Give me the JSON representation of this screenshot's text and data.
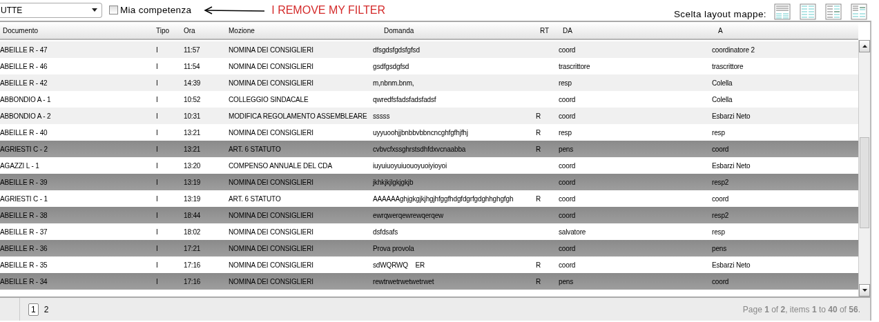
{
  "toolbar": {
    "filter": {
      "value": "UTTE"
    },
    "mia_competenza": {
      "label": "Mia competenza",
      "checked": false
    },
    "annotation": "I REMOVE MY FILTER",
    "layout_picker": {
      "label": "Scelta layout mappe:",
      "options": [
        {
          "kind": "top-list"
        },
        {
          "kind": "two-columns"
        },
        {
          "kind": "left-list"
        },
        {
          "kind": "corner-list"
        }
      ]
    }
  },
  "table": {
    "columns": [
      "Documento",
      "Tipo",
      "Ora",
      "Mozione",
      "Domanda",
      "RT",
      "DA",
      "A"
    ],
    "rows": [
      {
        "documento": "ABEILLE R - 47",
        "tipo": "I",
        "ora": "11:57",
        "mozione": "NOMINA DEI CONSIGLIERI",
        "domanda": "dfsgdsfgdsfgfsd",
        "da": "coord",
        "a": "coordinatore 2",
        "highlighted": false
      },
      {
        "documento": "ABEILLE R - 46",
        "tipo": "I",
        "ora": "11:54",
        "mozione": "NOMINA DEI CONSIGLIERI",
        "domanda": "gsdfgsdgfsd",
        "da": "trascrittore",
        "a": "trascrittore",
        "highlighted": false
      },
      {
        "documento": "ABEILLE R - 42",
        "tipo": "I",
        "ora": "14:39",
        "mozione": "NOMINA DEI CONSIGLIERI",
        "domanda": "m,nbnm.bnm,",
        "da": "resp",
        "a": "Colella",
        "highlighted": false
      },
      {
        "documento": "ABBONDIO A - 1",
        "tipo": "I",
        "ora": "10:52",
        "mozione": "COLLEGGIO SINDACALE",
        "domanda": "qwredfsfadsfadsfadsf",
        "da": "coord",
        "a": "Colella",
        "highlighted": false
      },
      {
        "documento": "ABBONDIO A - 2",
        "tipo": "I",
        "ora": "10:31",
        "mozione": "MODIFICA REGOLAMENTO ASSEMBLEARE",
        "domanda": "sssss",
        "rt": "R",
        "da": "coord",
        "a": "Esbarzi Neto",
        "highlighted": false
      },
      {
        "documento": "ABEILLE R - 40",
        "tipo": "I",
        "ora": "13:21",
        "mozione": "NOMINA DEI CONSIGLIERI",
        "domanda": "uyyuoohjjbnbbvbbncncghfgfhjfhj",
        "rt": "R",
        "da": "resp",
        "a": "resp",
        "highlighted": false
      },
      {
        "documento": "AGRIESTI C - 2",
        "tipo": "I",
        "ora": "13:21",
        "mozione": "ART. 6 STATUTO",
        "domanda": "cvbvcfxssghrstsdhfdxvcnaabba",
        "rt": "R",
        "da": "pens",
        "a": "coord",
        "highlighted": true
      },
      {
        "documento": "AGAZZI L - 1",
        "tipo": "I",
        "ora": "13:20",
        "mozione": "COMPENSO ANNUALE DEL CDA",
        "domanda": "iuyuiuoyuiuouoyuoiyioyoi",
        "da": "coord",
        "a": "Esbarzi Neto",
        "highlighted": false
      },
      {
        "documento": "ABEILLE R - 39",
        "tipo": "I",
        "ora": "13:19",
        "mozione": "NOMINA DEI CONSIGLIERI",
        "domanda": "jkhkjkjlgkjgkjb",
        "da": "coord",
        "a": "resp2",
        "highlighted": true
      },
      {
        "documento": "AGRIESTI C - 1",
        "tipo": "I",
        "ora": "13:19",
        "mozione": "ART. 6 STATUTO",
        "domanda": "AAAAAAghjgkgjkjhgjhfggfhdgfdgrfgdghhghgfgh",
        "rt": "R",
        "da": "coord",
        "a": "coord",
        "highlighted": false
      },
      {
        "documento": "ABEILLE R - 38",
        "tipo": "I",
        "ora": "18:44",
        "mozione": "NOMINA DEI CONSIGLIERI",
        "domanda": "ewrqwerqewrewqerqew",
        "da": "coord",
        "a": "resp2",
        "highlighted": true
      },
      {
        "documento": "ABEILLE R - 37",
        "tipo": "I",
        "ora": "18:02",
        "mozione": "NOMINA DEI CONSIGLIERI",
        "domanda": "dsfdsafs",
        "da": "salvatore",
        "a": "resp",
        "highlighted": false
      },
      {
        "documento": "ABEILLE R - 36",
        "tipo": "I",
        "ora": "17:21",
        "mozione": "NOMINA DEI CONSIGLIERI",
        "domanda": "Prova provola",
        "da": "coord",
        "a": "pens",
        "highlighted": true
      },
      {
        "documento": "ABEILLE R - 35",
        "tipo": "I",
        "ora": "17:16",
        "mozione": "NOMINA DEI CONSIGLIERI",
        "domanda": "sdWQRWQ    ER",
        "rt": "R",
        "da": "coord",
        "a": "Esbarzi Neto",
        "highlighted": false
      },
      {
        "documento": "ABEILLE R - 34",
        "tipo": "I",
        "ora": "17:16",
        "mozione": "NOMINA DEI CONSIGLIERI",
        "domanda": "rewtrwetrwetwetrwet",
        "rt": "R",
        "da": "pens",
        "a": "coord",
        "highlighted": true
      }
    ]
  },
  "pager": {
    "pages": [
      {
        "label": "1",
        "selected": true
      },
      {
        "label": "2",
        "selected": false
      }
    ],
    "summary": "Page **1** of **2**, items **1** to **40** of **56**."
  }
}
